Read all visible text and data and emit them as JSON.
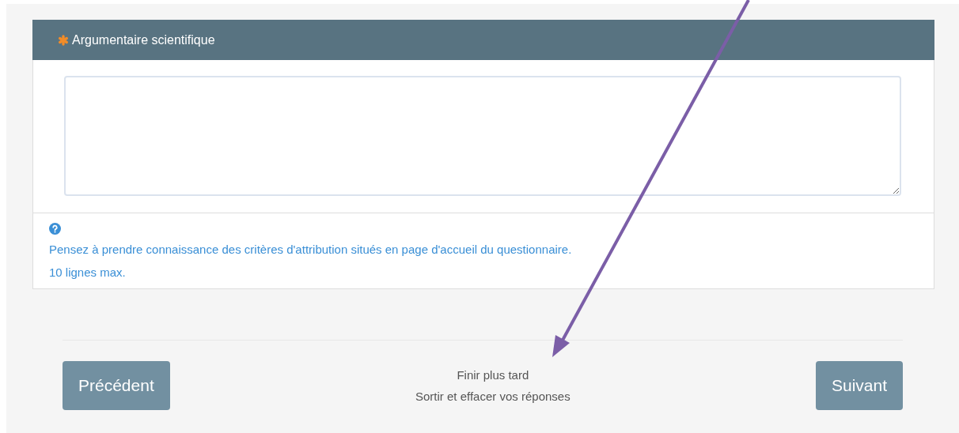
{
  "question": {
    "title": "Argumentaire scientifique",
    "required": true,
    "help": [
      "Pensez à prendre connaissance des critères d'attribution situés en page d'accueil du questionnaire.",
      "10 lignes max."
    ]
  },
  "navigation": {
    "previous": "Précédent",
    "next": "Suivant",
    "links": [
      "Finir plus tard",
      "Sortir et effacer vos réponses"
    ]
  }
}
